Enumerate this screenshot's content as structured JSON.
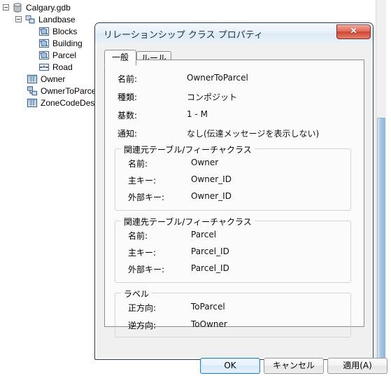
{
  "tree": {
    "items": [
      {
        "label": "Calgary.gdb",
        "icon": "geodatabase-icon",
        "depth": 0,
        "expander": "collapse"
      },
      {
        "label": "Landbase",
        "icon": "feature-dataset-icon",
        "depth": 1,
        "expander": "collapse"
      },
      {
        "label": "Blocks",
        "icon": "polygon-feature-class-icon",
        "depth": 2,
        "expander": "none"
      },
      {
        "label": "Building",
        "icon": "polygon-feature-class-icon",
        "depth": 2,
        "expander": "none"
      },
      {
        "label": "Parcel",
        "icon": "polygon-feature-class-icon",
        "depth": 2,
        "expander": "none"
      },
      {
        "label": "Road",
        "icon": "line-feature-class-icon",
        "depth": 2,
        "expander": "none"
      },
      {
        "label": "Owner",
        "icon": "table-icon",
        "depth": 1,
        "expander": "none"
      },
      {
        "label": "OwnerToParcel",
        "icon": "relationship-class-icon",
        "depth": 1,
        "expander": "none"
      },
      {
        "label": "ZoneCodeDesc",
        "icon": "table-icon",
        "depth": 1,
        "expander": "none"
      }
    ]
  },
  "dialog": {
    "title": "リレーションシップ クラス プロパティ",
    "close_glyph": "✕",
    "tabs": [
      {
        "label": "一般",
        "active": true
      },
      {
        "label": "ルール",
        "active": false
      }
    ],
    "general": {
      "fields": [
        {
          "label": "名前:",
          "value": "OwnerToParcel"
        },
        {
          "label": "種類:",
          "value": "コンポジット"
        },
        {
          "label": "基数:",
          "value": "1 - M"
        },
        {
          "label": "通知:",
          "value": "なし(伝達メッセージを表示しない)"
        }
      ],
      "origin_group": {
        "title": "関連元テーブル/フィーチャクラス",
        "rows": [
          {
            "label": "名前:",
            "value": "Owner"
          },
          {
            "label": "主キー:",
            "value": "Owner_ID"
          },
          {
            "label": "外部キー:",
            "value": "Owner_ID"
          }
        ]
      },
      "destination_group": {
        "title": "関連先テーブル/フィーチャクラス",
        "rows": [
          {
            "label": "名前:",
            "value": "Parcel"
          },
          {
            "label": "主キー:",
            "value": "Parcel_ID"
          },
          {
            "label": "外部キー:",
            "value": "Parcel_ID"
          }
        ]
      },
      "label_group": {
        "title": "ラベル",
        "rows": [
          {
            "label": "正方向:",
            "value": "ToParcel"
          },
          {
            "label": "逆方向:",
            "value": "ToOwner"
          }
        ]
      }
    },
    "buttons": {
      "ok": "OK",
      "cancel": "キャンセル",
      "apply": "適用(A)"
    }
  },
  "colors": {
    "title_text": "#1b3348",
    "close_button": "#cf4632",
    "default_button_border": "#3c7fb1",
    "dialog_face": "#f0f0f0",
    "tabpage_face": "#fbfbfb",
    "scrollbar_thumb": "#8fb8da"
  }
}
